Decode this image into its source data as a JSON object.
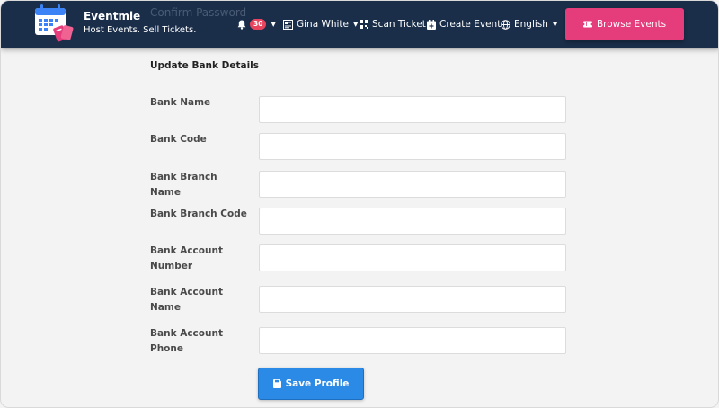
{
  "header": {
    "background_color": "#1a2e4a",
    "ghost_text": "Confirm Password",
    "brand_name": "Eventmie",
    "tagline": "Host Events. Sell Tickets.",
    "notifications": {
      "icon": "bell-icon",
      "count": "30"
    },
    "user": {
      "icon": "id-card-icon",
      "name": "Gina White"
    },
    "scan_ticket": {
      "icon": "qrcode-icon",
      "label": "Scan Ticket"
    },
    "create_event": {
      "icon": "calendar-plus-icon",
      "label": "Create Event"
    },
    "language": {
      "icon": "globe-icon",
      "label": "English"
    },
    "browse_events": {
      "icon": "ticket-icon",
      "label": "Browse Events",
      "color": "#e53c7c"
    }
  },
  "form": {
    "title": "Update Bank Details",
    "fields": [
      {
        "label": "Bank Name",
        "value": ""
      },
      {
        "label": "Bank Code",
        "value": ""
      },
      {
        "label": "Bank Branch Name",
        "value": ""
      },
      {
        "label": "Bank Branch Code",
        "value": ""
      },
      {
        "label": "Bank Account Number",
        "value": ""
      },
      {
        "label": "Bank Account Name",
        "value": ""
      },
      {
        "label": "Bank Account Phone",
        "value": ""
      }
    ],
    "save_button": {
      "icon": "save-icon",
      "label": "Save Profile",
      "color": "#2b8ae6"
    }
  }
}
